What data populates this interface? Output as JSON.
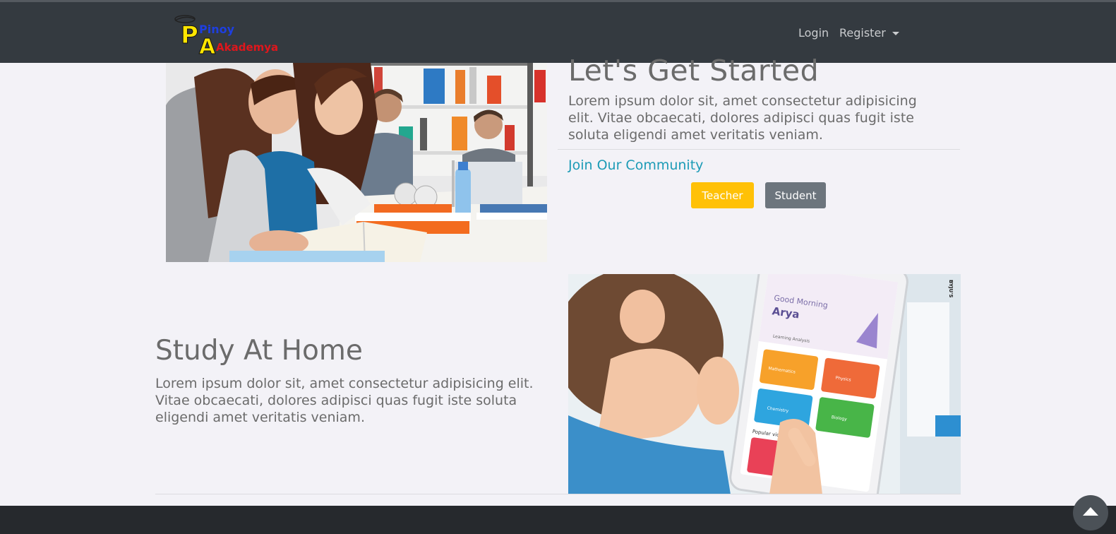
{
  "navbar": {
    "logo_text_line1": "Pinoy",
    "logo_text_line2": "Akademya",
    "login_label": "Login",
    "register_label": "Register"
  },
  "hero": {
    "title": "Let's Get Started",
    "body": "Lorem ipsum dolor sit, amet consectetur adipisicing elit. Vitae obcaecati, dolores adipisci quas fugit iste soluta eligendi amet veritatis veniam.",
    "join_label": "Join Our Community",
    "teacher_label": "Teacher",
    "student_label": "Student"
  },
  "study": {
    "title": "Study At Home",
    "body": "Lorem ipsum dolor sit, amet consectetur adipisicing elit. Vitae obcaecati, dolores adipisci quas fugit iste soluta eligendi amet veritatis veniam."
  },
  "tablet_screen": {
    "greeting": "Good Morning",
    "name": "Arya",
    "analytics": "Learning Analysis",
    "tiles": [
      "Mathematics",
      "Physics",
      "Chemistry",
      "Biology"
    ],
    "popular": "Popular videos",
    "watermark": "BYJU'S"
  },
  "colors": {
    "navbar": "#343a40",
    "page_bg": "#f3f2f7",
    "link_accent": "#1c9bb6",
    "teacher_button": "#ffc107",
    "student_button": "#6c757d",
    "footer": "#26292d"
  },
  "icons": {
    "scroll_top": "arrow-up-icon",
    "register_caret": "caret-down-icon"
  }
}
